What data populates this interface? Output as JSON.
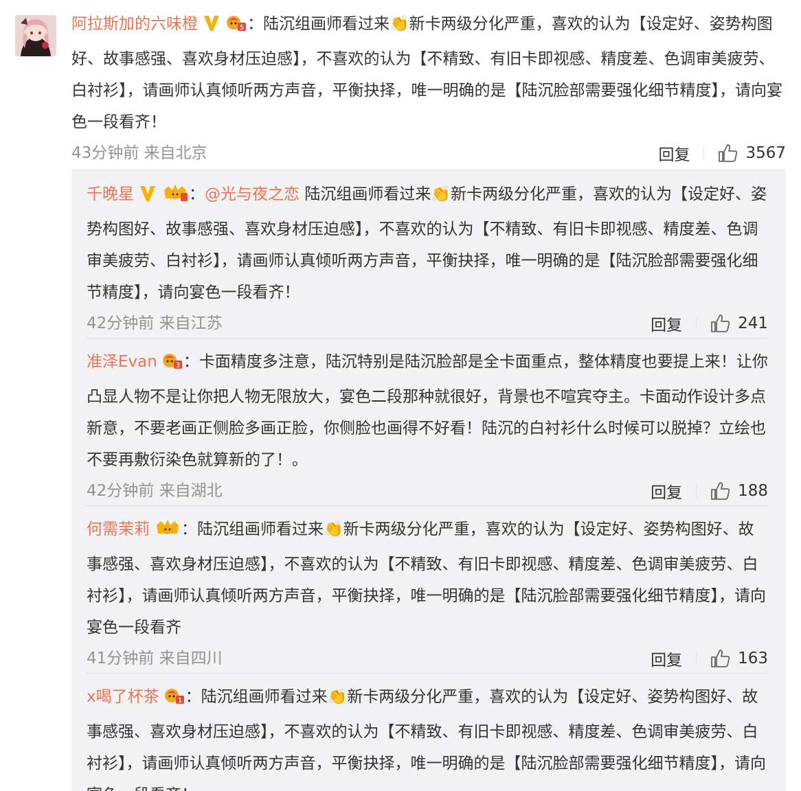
{
  "main": {
    "user": "阿拉斯加的六味橙",
    "text": "陆沉组画师看过来👏新卡两级分化严重，喜欢的认为【设定好、姿势构图好、故事感强、喜欢身材压迫感】，不喜欢的认为【不精致、有旧卡即视感、精度差、色调审美疲劳、白衬衫】，请画师认真倾听两方声音，平衡抉择，唯一明确的是【陆沉脸部需要强化细节精度】，请向宴色一段看齐！",
    "time": "43分钟前 来自北京",
    "reply_label": "回复",
    "likes": "3567",
    "badge_level": "5"
  },
  "replies": [
    {
      "user": "千晚星",
      "mention": "@光与夜之恋",
      "text": "陆沉组画师看过来👏新卡两级分化严重，喜欢的认为【设定好、姿势构图好、故事感强、喜欢身材压迫感】，不喜欢的认为【不精致、有旧卡即视感、精度差、色调审美疲劳、白衬衫】，请画师认真倾听两方声音，平衡抉择，唯一明确的是【陆沉脸部需要强化细节精度】，请向宴色一段看齐！",
      "time": "42分钟前 来自江苏",
      "reply_label": "回复",
      "likes": "241"
    },
    {
      "user": "准泽Evan",
      "text": "卡面精度多注意，陆沉特别是陆沉脸部是全卡面重点，整体精度也要提上来！让你凸显人物不是让你把人物无限放大，宴色二段那种就很好，背景也不喧宾夺主。卡面动作设计多点新意，不要老画正侧脸多画正脸，你侧脸也画得不好看！陆沉的白衬衫什么时候可以脱掉？立绘也不要再敷衍染色就算新的了！。",
      "time": "42分钟前 来自湖北",
      "reply_label": "回复",
      "likes": "188",
      "badge_level": "3"
    },
    {
      "user": "何需茉莉",
      "text": "陆沉组画师看过来👏新卡两级分化严重，喜欢的认为【设定好、姿势构图好、故事感强、喜欢身材压迫感】，不喜欢的认为【不精致、有旧卡即视感、精度差、色调审美疲劳、白衬衫】，请画师认真倾听两方声音，平衡抉择，唯一明确的是【陆沉脸部需要强化细节精度】，请向宴色一段看齐",
      "time": "41分钟前 来自四川",
      "reply_label": "回复",
      "likes": "163"
    },
    {
      "user": "x喝了杯茶",
      "text": "陆沉组画师看过来👏新卡两级分化严重，喜欢的认为【设定好、姿势构图好、故事感强、喜欢身材压迫感】，不喜欢的认为【不精致、有旧卡即视感、精度差、色调审美疲劳、白衬衫】，请画师认真倾听两方声音，平衡抉择，唯一明确的是【陆沉脸部需要强化细节精度】，请向宴色一段看齐！",
      "badge_level": "1"
    }
  ],
  "colors": {
    "username": "#eb7350",
    "time": "#939393",
    "reply_bg": "#f2f2f5",
    "vip": "#f6b200"
  },
  "icons": {
    "verified": "v-badge-icon",
    "fan_badge": "fan-badge-icon",
    "crown_badge": "crown-badge-icon",
    "like": "thumbs-up-icon"
  }
}
